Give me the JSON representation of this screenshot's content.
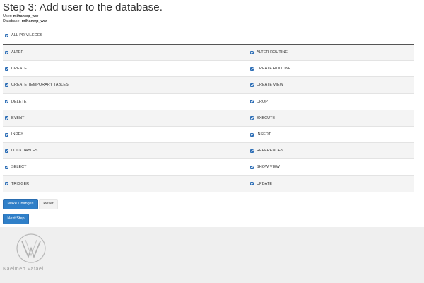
{
  "header": {
    "title": "Step 3: Add user to the database.",
    "user_label": "User:",
    "user_value": "mihanwp_ww",
    "database_label": "Database:",
    "database_value": "mihanwp_ww"
  },
  "all_privileges": {
    "label": "ALL PRIVILEGES",
    "checked": true
  },
  "privileges": {
    "rows": [
      {
        "left": "ALTER",
        "right": "ALTER ROUTINE"
      },
      {
        "left": "CREATE",
        "right": "CREATE ROUTINE"
      },
      {
        "left": "CREATE TEMPORARY TABLES",
        "right": "CREATE VIEW"
      },
      {
        "left": "DELETE",
        "right": "DROP"
      },
      {
        "left": "EVENT",
        "right": "EXECUTE"
      },
      {
        "left": "INDEX",
        "right": "INSERT"
      },
      {
        "left": "LOCK TABLES",
        "right": "REFERENCES"
      },
      {
        "left": "SELECT",
        "right": "SHOW VIEW"
      },
      {
        "left": "TRIGGER",
        "right": "UPDATE"
      }
    ]
  },
  "actions": {
    "make_changes": "Make Changes",
    "reset": "Reset",
    "next_step": "Next Step"
  },
  "watermark": {
    "text": "Naeimeh Vafaei"
  },
  "colors": {
    "checkbox": "#2f6fb6",
    "primary_button": "#2f7fc8",
    "row_alt": "#f4f4f4",
    "footer": "#efefef"
  }
}
